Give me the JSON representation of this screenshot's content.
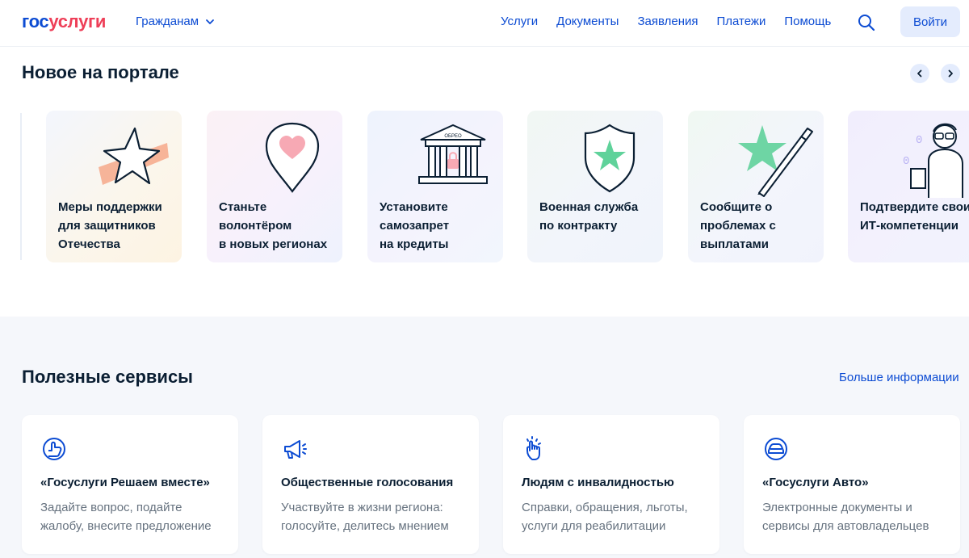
{
  "header": {
    "logo_part1": "гос",
    "logo_part2": "услуги",
    "audience": "Гражданам",
    "nav": [
      "Услуги",
      "Документы",
      "Заявления",
      "Платежи",
      "Помощь"
    ],
    "login": "Войти"
  },
  "news": {
    "title": "Новое на портале",
    "cards": [
      {
        "lines": [
          "Меры поддержки",
          "для защитников",
          "Отечества"
        ],
        "icon": "star-icon"
      },
      {
        "lines": [
          "Станьте",
          "волонтёром",
          "в новых регионах"
        ],
        "icon": "heart-pin-icon"
      },
      {
        "lines": [
          "Установите",
          "самозапрет",
          "на кредиты"
        ],
        "icon": "bank-lock-icon",
        "sign_text": "ОБРЕО"
      },
      {
        "lines": [
          "Военная служба",
          "по контракту"
        ],
        "icon": "shield-star-icon"
      },
      {
        "lines": [
          "Сообщите о",
          "проблемах с",
          "выплатами"
        ],
        "icon": "star-pen-icon"
      },
      {
        "lines": [
          "Подтвердите свои",
          "ИТ-компетенции"
        ],
        "icon": "it-specialist-icon"
      }
    ]
  },
  "services": {
    "title": "Полезные сервисы",
    "more": "Больше информации",
    "cards": [
      {
        "title": "«Госуслуги Решаем вместе»",
        "desc": [
          "Задайте вопрос, подайте",
          "жалобу, внесите предложение"
        ],
        "icon": "hand-like-icon"
      },
      {
        "title": "Общественные голосования",
        "desc": [
          "Участвуйте в жизни региона:",
          "голосуйте, делитесь мнением"
        ],
        "icon": "megaphone-icon"
      },
      {
        "title": "Людям с инвалидностью",
        "desc": [
          "Справки, обращения, льготы,",
          "услуги для реабилитации"
        ],
        "icon": "touch-hand-icon"
      },
      {
        "title": "«Госуслуги Авто»",
        "desc": [
          "Электронные документы и",
          "сервисы для автовладельцев"
        ],
        "icon": "car-icon"
      }
    ]
  },
  "colors": {
    "brand_blue": "#0d4cd3",
    "brand_red": "#ee3f58",
    "text_dark": "#0b1f33",
    "text_muted": "#66727f",
    "accent_green": "#5fd29a",
    "accent_pink": "#f7a9b4",
    "accent_orange": "#f6a88a"
  }
}
